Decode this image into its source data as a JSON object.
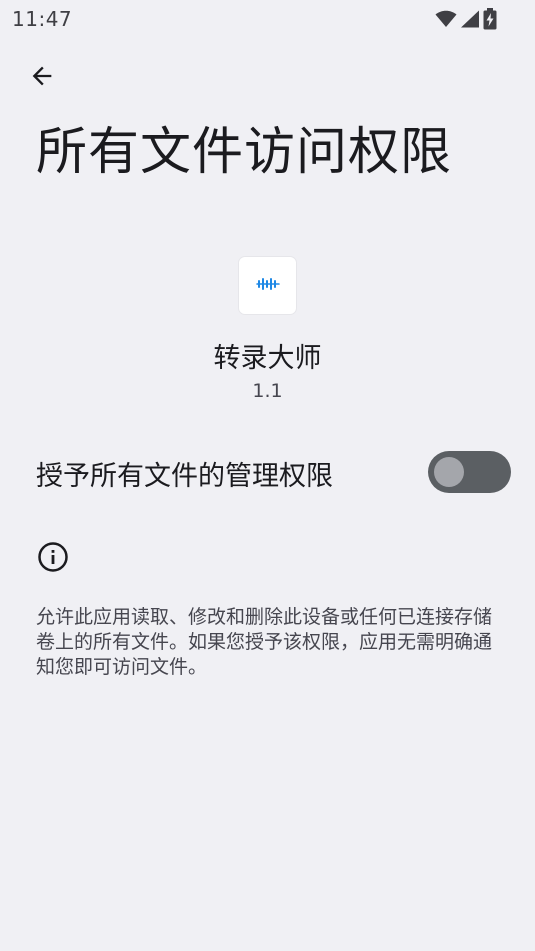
{
  "status_bar": {
    "time": "11:47"
  },
  "header": {
    "title": "所有文件访问权限"
  },
  "app": {
    "name": "转录大师",
    "version": "1.1"
  },
  "permission": {
    "label": "授予所有文件的管理权限",
    "enabled": false
  },
  "info": {
    "description": "允许此应用读取、修改和删除此设备或任何已连接存储卷上的所有文件。如果您授予该权限，应用无需明确通知您即可访问文件。"
  },
  "colors": {
    "background": "#f0f0f4",
    "toggle_track": "#5b5f63",
    "toggle_thumb": "#a4a6ab",
    "app_icon_accent": "#1e88e5"
  }
}
